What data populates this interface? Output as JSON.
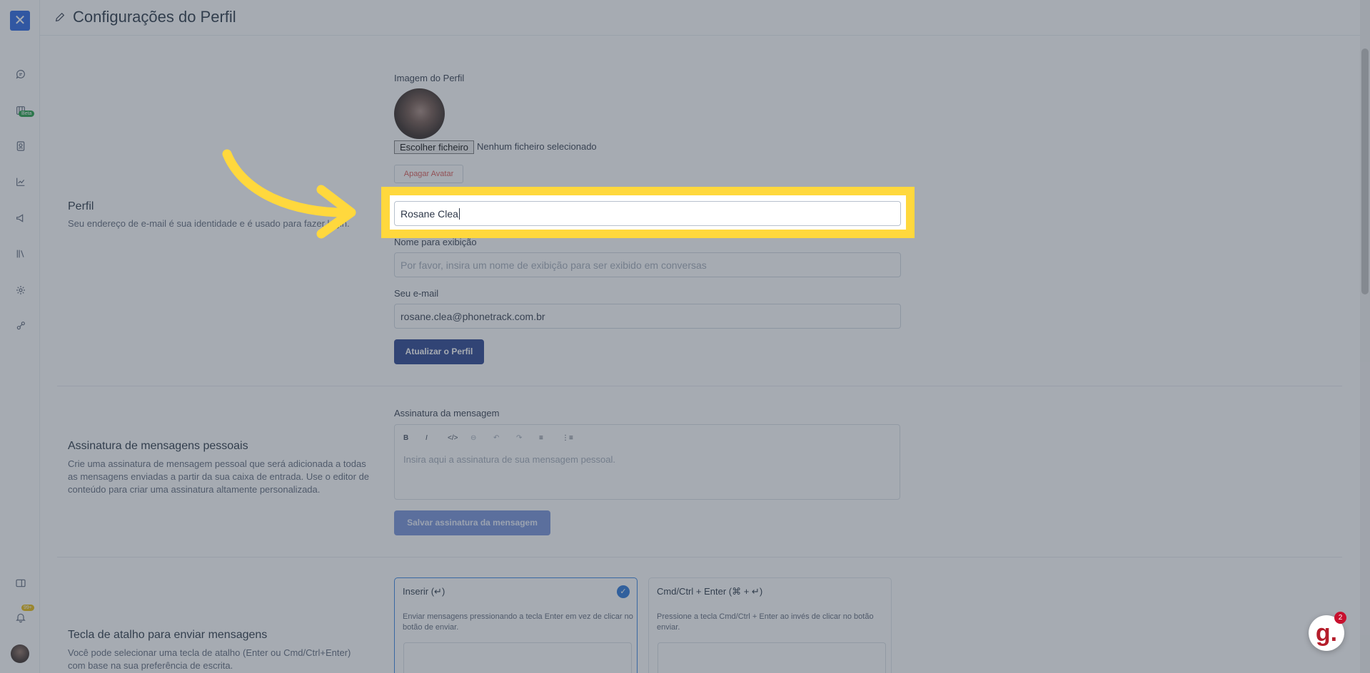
{
  "header": {
    "title": "Configurações do Perfil"
  },
  "sidebar": {
    "items": [
      {
        "name": "conversations-icon"
      },
      {
        "name": "kanban-icon",
        "badge": "Beta"
      },
      {
        "name": "contacts-icon"
      },
      {
        "name": "reports-icon"
      },
      {
        "name": "campaigns-icon"
      },
      {
        "name": "library-icon"
      },
      {
        "name": "settings-icon"
      },
      {
        "name": "integrations-icon"
      }
    ],
    "notifications_badge": "99+"
  },
  "profile": {
    "title": "Perfil",
    "description": "Seu endereço de e-mail é sua identidade e é usado para fazer login.",
    "image_label": "Imagem do Perfil",
    "file_button": "Escolher ficheiro",
    "file_status": "Nenhum ficheiro selecionado",
    "delete_avatar": "Apagar Avatar",
    "name_value": "Rosane Clea",
    "display_name_label": "Nome para exibição",
    "display_name_placeholder": "Por favor, insira um nome de exibição para ser exibido em conversas",
    "email_label": "Seu e-mail",
    "email_value": "rosane.clea@phonetrack.com.br",
    "update_button": "Atualizar o Perfil"
  },
  "signature": {
    "title": "Assinatura de mensagens pessoais",
    "description": "Crie uma assinatura de mensagem pessoal que será adicionada a todas as mensagens enviadas a partir da sua caixa de entrada. Use o editor de conteúdo para criar uma assinatura altamente personalizada.",
    "label": "Assinatura da mensagem",
    "placeholder": "Insira aqui a assinatura de sua mensagem pessoal.",
    "save_button": "Salvar assinatura da mensagem",
    "toolbar": [
      "B",
      "I",
      "</>",
      "⊖",
      "↶",
      "↷",
      "≡",
      "⋮≡"
    ]
  },
  "hotkey": {
    "title": "Tecla de atalho para enviar mensagens",
    "description": "Você pode selecionar uma tecla de atalho (Enter ou Cmd/Ctrl+Enter) com base na sua preferência de escrita.",
    "options": [
      {
        "title": "Inserir (↵)",
        "description": "Enviar mensagens pressionando a tecla Enter em vez de clicar no botão de enviar.",
        "selected": true
      },
      {
        "title": "Cmd/Ctrl + Enter (⌘ + ↵)",
        "description": "Pressione a tecla Cmd/Ctrl + Enter ao invés de clicar no botão enviar.",
        "selected": false
      }
    ]
  },
  "widget": {
    "badge": "2",
    "letter": "g."
  }
}
